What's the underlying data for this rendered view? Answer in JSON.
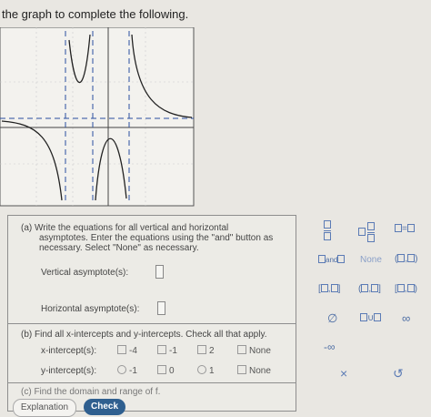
{
  "instruction": "the graph to complete the following.",
  "part_a": {
    "line1": "(a)  Write the equations for all vertical and horizontal",
    "line2": "asymptotes. Enter the equations using the \"and\" button as",
    "line3": "necessary. Select \"None\" as necessary.",
    "vertical_label": "Vertical asymptote(s):",
    "horizontal_label": "Horizontal asymptote(s):"
  },
  "part_b": {
    "prompt": "(b)  Find all x-intercepts and y-intercepts. Check all that apply.",
    "x_label": "x-intercept(s):",
    "x_options": [
      "-4",
      "-1",
      "2",
      "None"
    ],
    "y_label": "y-intercept(s):",
    "y_options": [
      "-1",
      "0",
      "1",
      "None"
    ]
  },
  "part_c": {
    "prompt": "(c)  Find the domain and range of f."
  },
  "palette": {
    "and_symbol": "and",
    "none_label": "None",
    "neg_infinity": "-∞",
    "infinity": "∞",
    "empty_set": "∅",
    "union": "∪",
    "times": "×",
    "undo": "↺"
  },
  "buttons": {
    "explanation": "Explanation",
    "check": "Check"
  }
}
